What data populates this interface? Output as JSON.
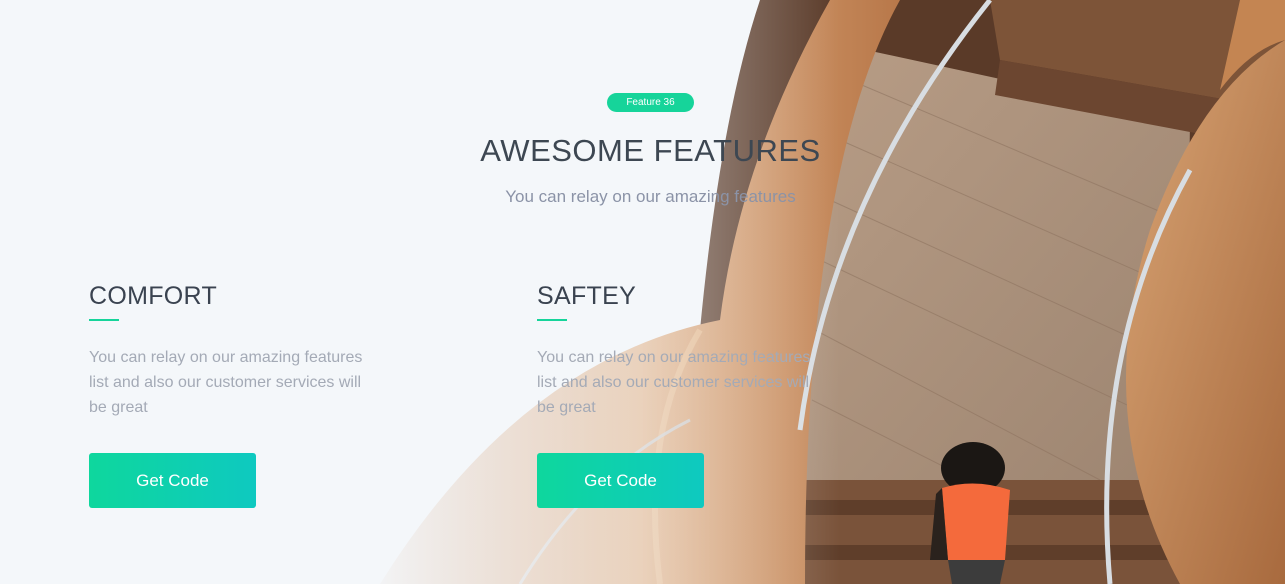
{
  "badge": {
    "label": "Feature 36"
  },
  "hero": {
    "title": "AWESOME FEATURES",
    "subtitle": "You can relay on our amazing features"
  },
  "features": [
    {
      "title": "COMFORT",
      "description": "You can relay on our amazing features list and also our customer services will be great",
      "button_label": "Get Code"
    },
    {
      "title": "SAFTEY",
      "description": "You can relay on our amazing features list and also our customer services will be great",
      "button_label": "Get Code"
    }
  ],
  "colors": {
    "background": "#f4f7fa",
    "accent": "#16d49a",
    "button_gradient_start": "#0ed79d",
    "button_gradient_end": "#0ec9c0",
    "heading": "#3d4752",
    "muted_text": "#a4aab6"
  },
  "background_image": {
    "subject": "spiral wooden staircase with person in orange top"
  }
}
